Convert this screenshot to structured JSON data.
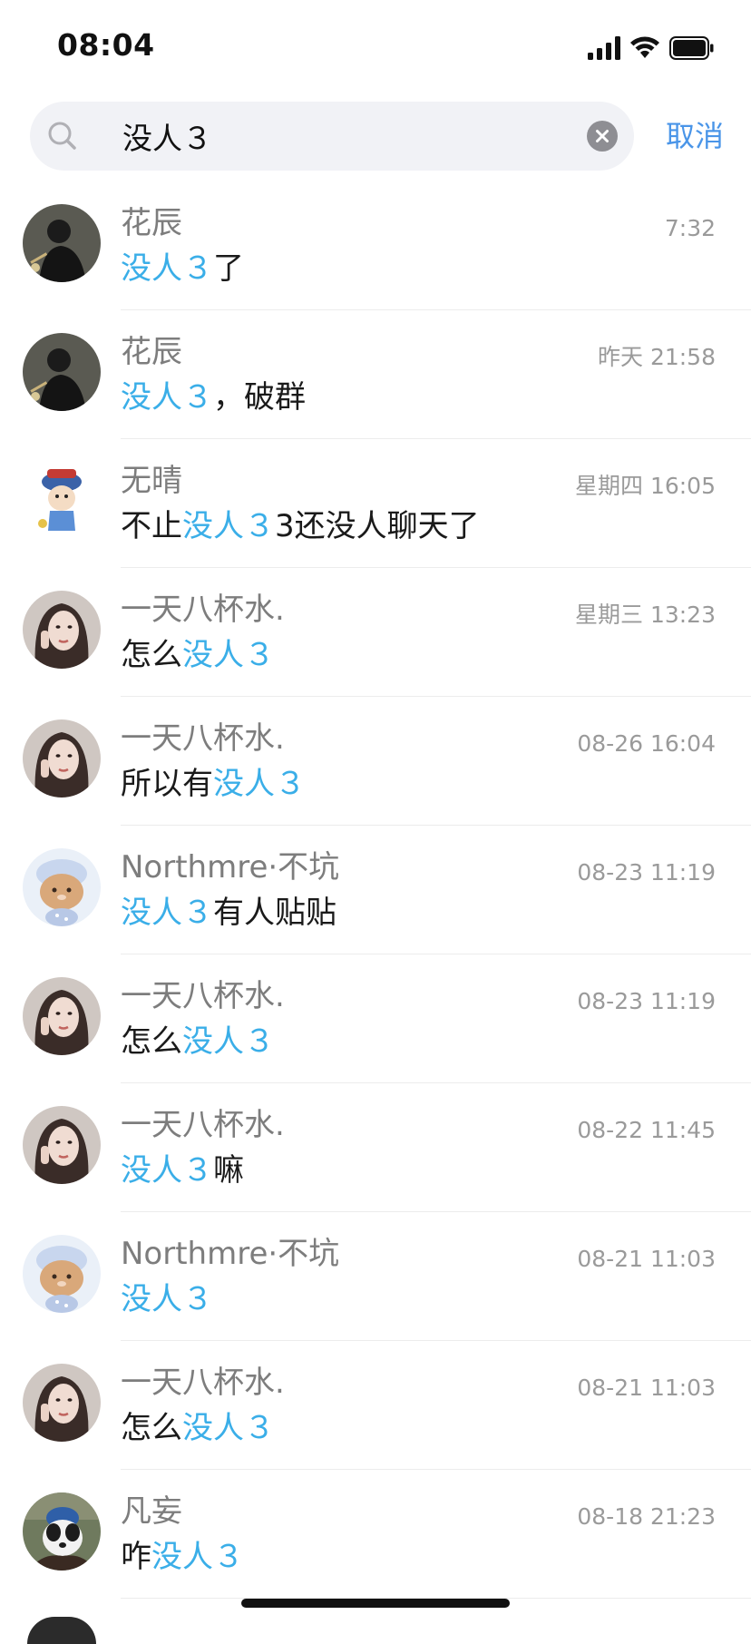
{
  "status_bar": {
    "time": "08:04"
  },
  "search": {
    "query": "没人３",
    "cancel_label": "取消",
    "highlight_color": "#3aaee8"
  },
  "results": [
    {
      "name": "花辰",
      "time": "7:32",
      "avatar": "dark-photo-avatar",
      "message": [
        {
          "text": "没人３",
          "hl": true
        },
        {
          "text": "了",
          "hl": false
        }
      ]
    },
    {
      "name": "花辰",
      "time": "昨天 21:58",
      "avatar": "dark-photo-avatar",
      "message": [
        {
          "text": "没人３",
          "hl": true
        },
        {
          "text": "，破群",
          "hl": false
        }
      ]
    },
    {
      "name": "无晴",
      "time": "星期四 16:05",
      "avatar": "cartoon-official-avatar",
      "message": [
        {
          "text": "不止",
          "hl": false
        },
        {
          "text": "没人３",
          "hl": true
        },
        {
          "text": "3还没人聊天了",
          "hl": false
        }
      ]
    },
    {
      "name": "一天八杯水.",
      "time": "星期三 13:23",
      "avatar": "woman-portrait-avatar",
      "message": [
        {
          "text": "怎么",
          "hl": false
        },
        {
          "text": "没人３",
          "hl": true
        }
      ]
    },
    {
      "name": "一天八杯水.",
      "time": "08-26 16:04",
      "avatar": "woman-portrait-avatar",
      "message": [
        {
          "text": "所以有",
          "hl": false
        },
        {
          "text": "没人３",
          "hl": true
        }
      ]
    },
    {
      "name": "Northmre·不坑",
      "time": "08-23 11:19",
      "avatar": "cartoon-bear-avatar",
      "message": [
        {
          "text": "没人３",
          "hl": true
        },
        {
          "text": "有人贴贴",
          "hl": false
        }
      ]
    },
    {
      "name": "一天八杯水.",
      "time": "08-23 11:19",
      "avatar": "woman-portrait-avatar",
      "message": [
        {
          "text": "怎么",
          "hl": false
        },
        {
          "text": "没人３",
          "hl": true
        }
      ]
    },
    {
      "name": "一天八杯水.",
      "time": "08-22 11:45",
      "avatar": "woman-portrait-avatar",
      "message": [
        {
          "text": "没人３",
          "hl": true
        },
        {
          "text": "嘛",
          "hl": false
        }
      ]
    },
    {
      "name": "Northmre·不坑",
      "time": "08-21 11:03",
      "avatar": "cartoon-bear-avatar",
      "message": [
        {
          "text": "没人３",
          "hl": true
        }
      ]
    },
    {
      "name": "一天八杯水.",
      "time": "08-21 11:03",
      "avatar": "woman-portrait-avatar",
      "message": [
        {
          "text": "怎么",
          "hl": false
        },
        {
          "text": "没人３",
          "hl": true
        }
      ]
    },
    {
      "name": "凡妄",
      "time": "08-18 21:23",
      "avatar": "dog-photo-avatar",
      "message": [
        {
          "text": "咋",
          "hl": false
        },
        {
          "text": "没人３",
          "hl": true
        }
      ]
    }
  ]
}
